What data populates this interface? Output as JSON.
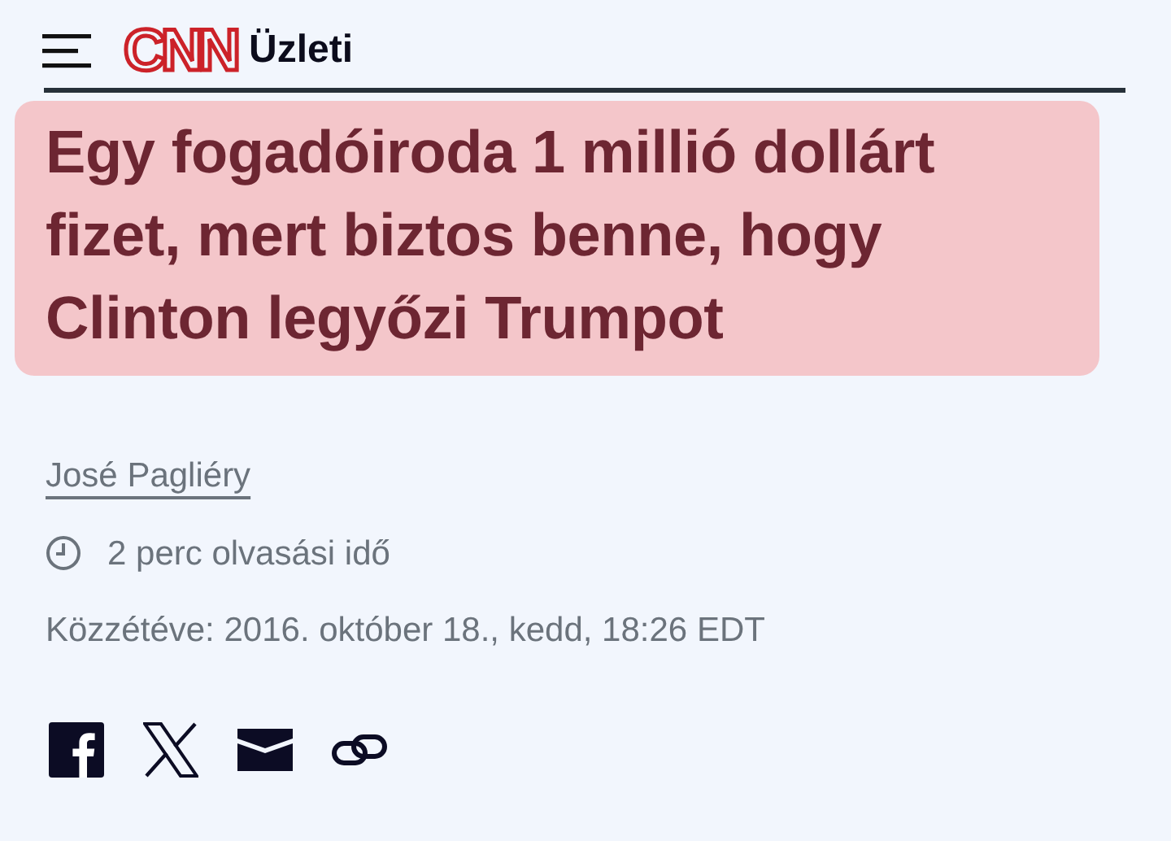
{
  "header": {
    "logo": "CNN",
    "section": "Üzleti"
  },
  "headline": "Egy fogadóiroda 1 millió dollárt fizet, mert biztos benne, hogy Clinton legyőzi Trumpot",
  "author": "José Pagliéry",
  "reading_time": "2 perc olvasási idő",
  "published": "Közzétéve: 2016. október 18., kedd, 18:26 EDT",
  "share": [
    {
      "kind": "facebook"
    },
    {
      "kind": "x"
    },
    {
      "kind": "email"
    },
    {
      "kind": "link"
    }
  ]
}
